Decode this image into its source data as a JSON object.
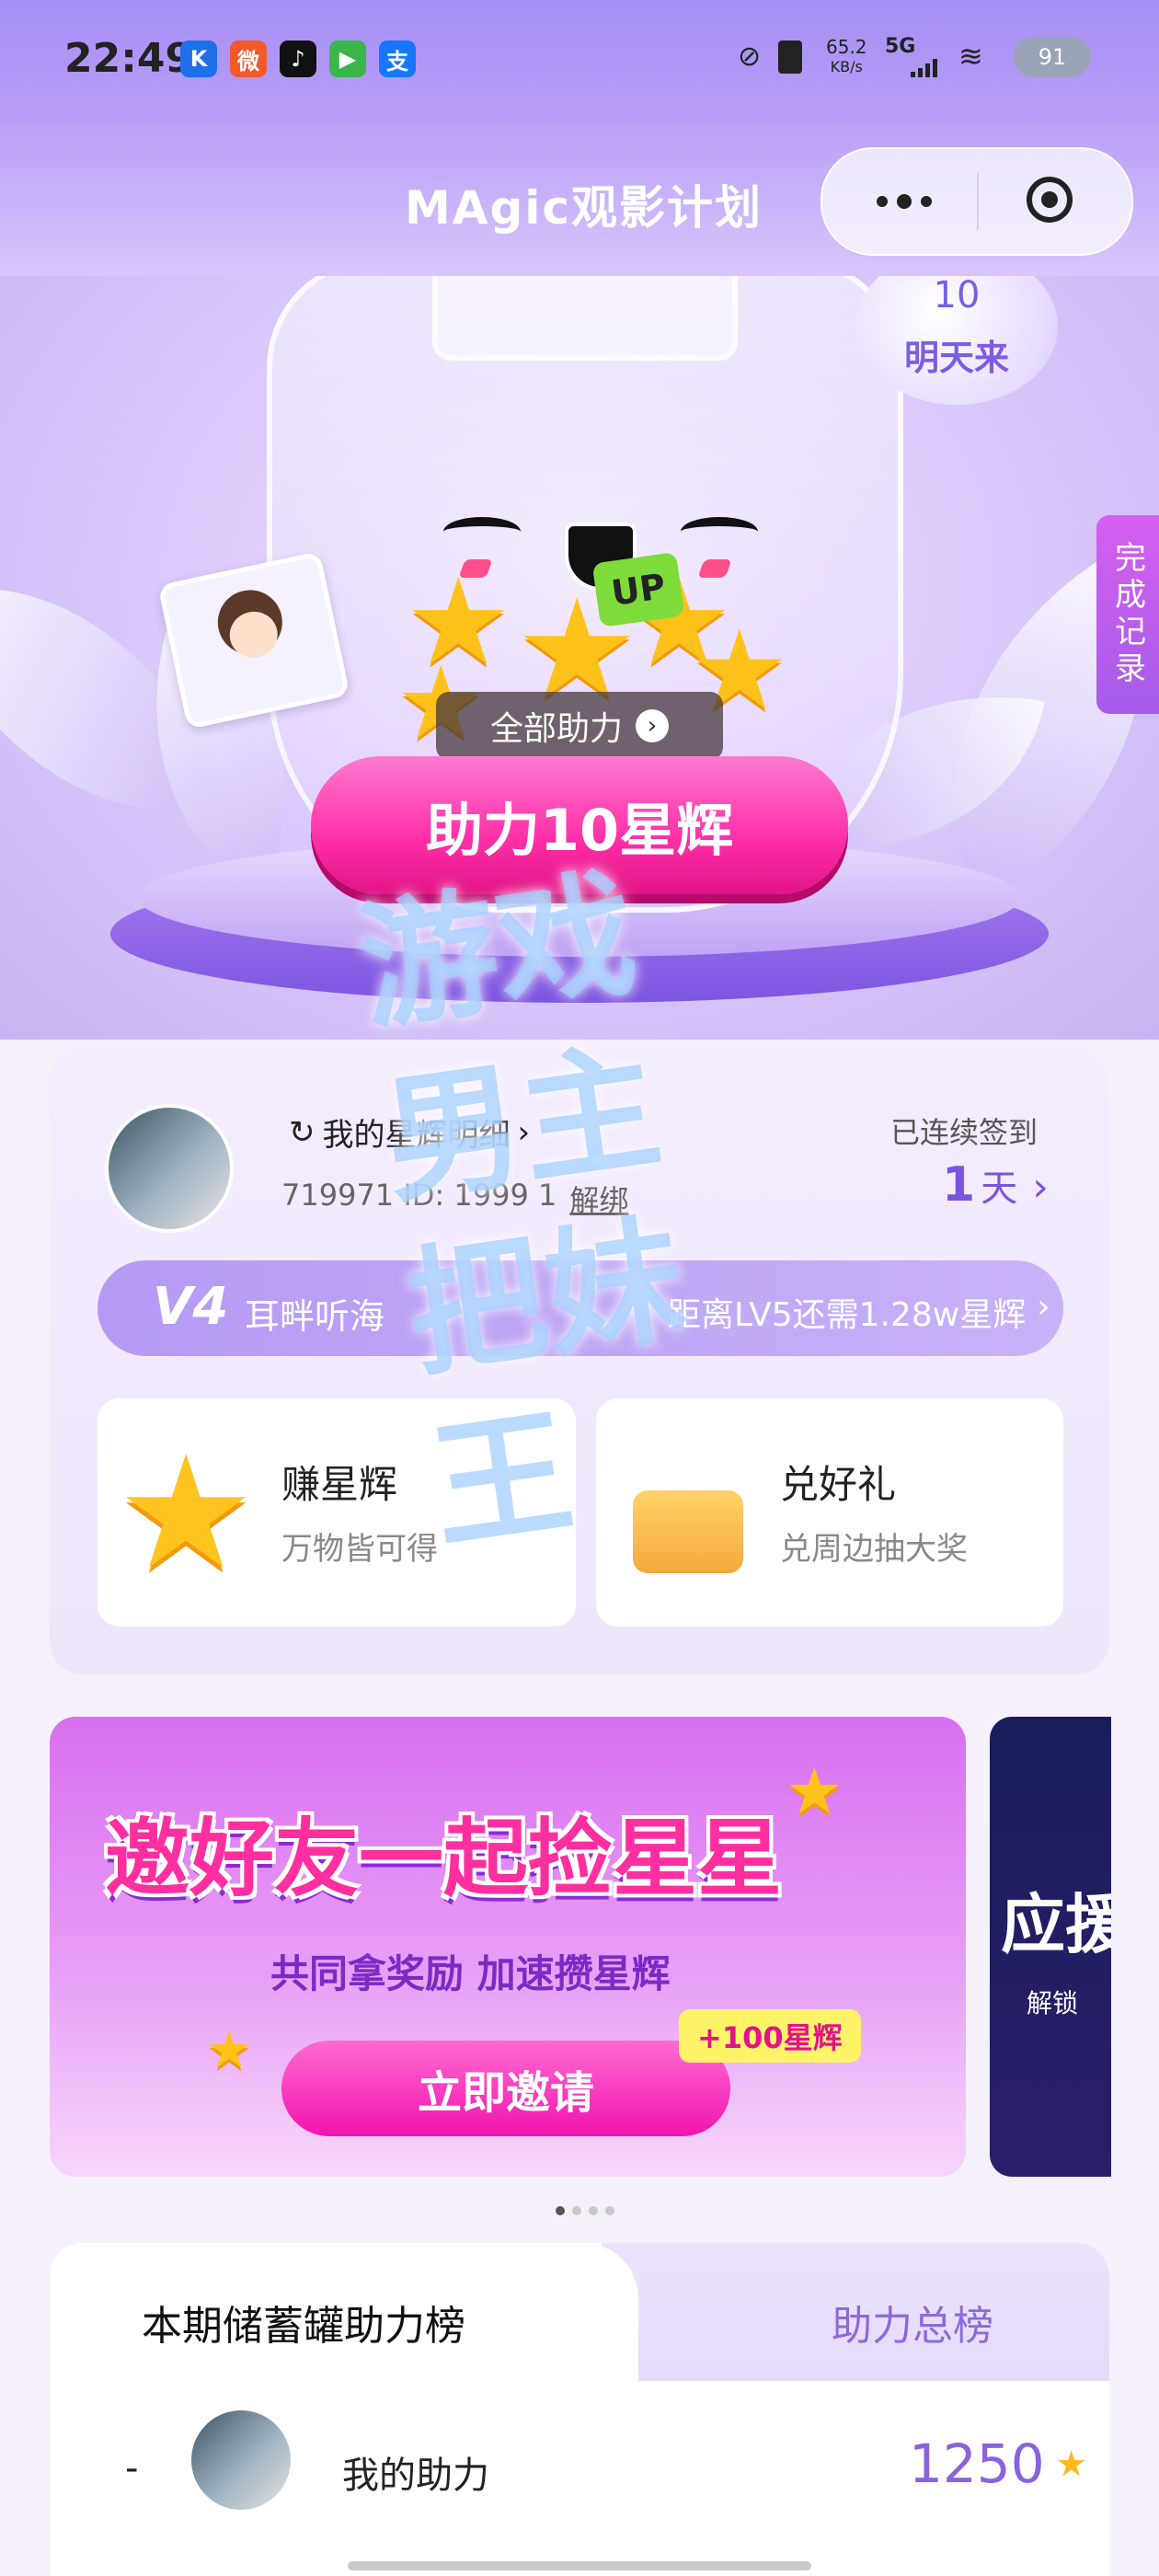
{
  "status_bar": {
    "time": "22:49",
    "apps": [
      {
        "icon": "k-app-icon",
        "glyph": "K",
        "color": "#1f6fe8"
      },
      {
        "icon": "weibo-icon",
        "glyph": "微",
        "color": "#f25a2a"
      },
      {
        "icon": "tiktok-icon",
        "glyph": "♪",
        "color": "#111111"
      },
      {
        "icon": "play-app-icon",
        "glyph": "▶",
        "color": "#39b54a"
      },
      {
        "icon": "alipay-icon",
        "glyph": "支",
        "color": "#1677ff"
      }
    ],
    "speed": "65.2",
    "speed_unit": "KB/s",
    "network": "5G",
    "battery": "91"
  },
  "header": {
    "title": "MAgic观影计划",
    "more_icon": "more-dots-icon",
    "close_icon": "target-close-icon"
  },
  "hero": {
    "bubble_number": "10",
    "bubble_text": "明天来",
    "up_badge": "UP",
    "all_help_label": "全部助力",
    "help_button": "助力10星辉",
    "record_tab": "完成记录"
  },
  "watermark": {
    "text": "游戏男主把妹王"
  },
  "profile": {
    "link_label": "我的星辉明细",
    "user_id": "719971 ID: 1999 1",
    "unbind": "解绑",
    "checkin_label": "已连续签到",
    "checkin_days": "1",
    "checkin_unit": "天",
    "level_badge": "V4",
    "level_name": "耳畔听海",
    "level_progress": "距离LV5还需1.28w星辉",
    "earn_title": "赚星辉",
    "earn_sub": "万物皆可得",
    "exchange_title": "兑好礼",
    "exchange_sub": "兑周边抽大奖"
  },
  "banner": {
    "headline": "邀好友一起捡星星",
    "subline": "共同拿奖励 加速攒星辉",
    "bonus_tag": "+100星辉",
    "button": "立即邀请",
    "next_banner_title": "应援",
    "next_banner_sub": "解锁"
  },
  "pager": {
    "count": 4,
    "active": 0
  },
  "board": {
    "tab_active": "本期储蓄罐助力榜",
    "tab_inactive": "助力总榜",
    "rank": "-",
    "row_label": "我的助力",
    "row_value": "1250"
  }
}
